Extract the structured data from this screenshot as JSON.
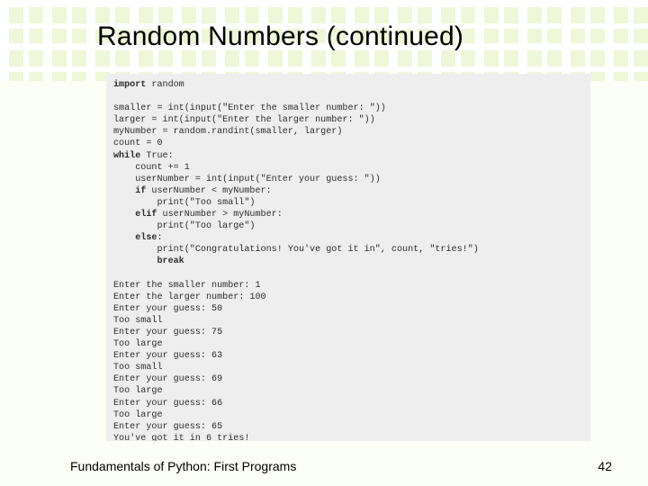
{
  "title": "Random Numbers (continued)",
  "footer": {
    "left": "Fundamentals of Python: First Programs",
    "right": "42"
  },
  "code": {
    "l01_k": "import",
    "l01_r": " random",
    "l03_a": "smaller = int(input(\"Enter the smaller number: \"))",
    "l04_a": "larger = int(input(\"Enter the larger number: \"))",
    "l05_a": "myNumber = random.randint(smaller, larger)",
    "l06_a": "count = 0",
    "l07_k": "while",
    "l07_r": " True:",
    "l08_a": "count += 1",
    "l09_a": "userNumber = int(input(\"Enter your guess: \"))",
    "l10_k": "if",
    "l10_r": " userNumber < myNumber:",
    "l11_a": "print(\"Too small\")",
    "l12_k": "elif",
    "l12_r": " userNumber > myNumber:",
    "l13_a": "print(\"Too large\")",
    "l14_k": "else",
    "l14_r": ":",
    "l15_a": "print(\"Congratulations! You've got it in\", count, \"tries!\")",
    "l16_k": "break"
  },
  "output": {
    "o01": "Enter the smaller number: 1",
    "o02": "Enter the larger number: 100",
    "o03": "Enter your guess: 50",
    "o04": "Too small",
    "o05": "Enter your guess: 75",
    "o06": "Too large",
    "o07": "Enter your guess: 63",
    "o08": "Too small",
    "o09": "Enter your guess: 69",
    "o10": "Too large",
    "o11": "Enter your guess: 66",
    "o12": "Too large",
    "o13": "Enter your guess: 65",
    "o14": "You've got it in 6 tries!"
  }
}
